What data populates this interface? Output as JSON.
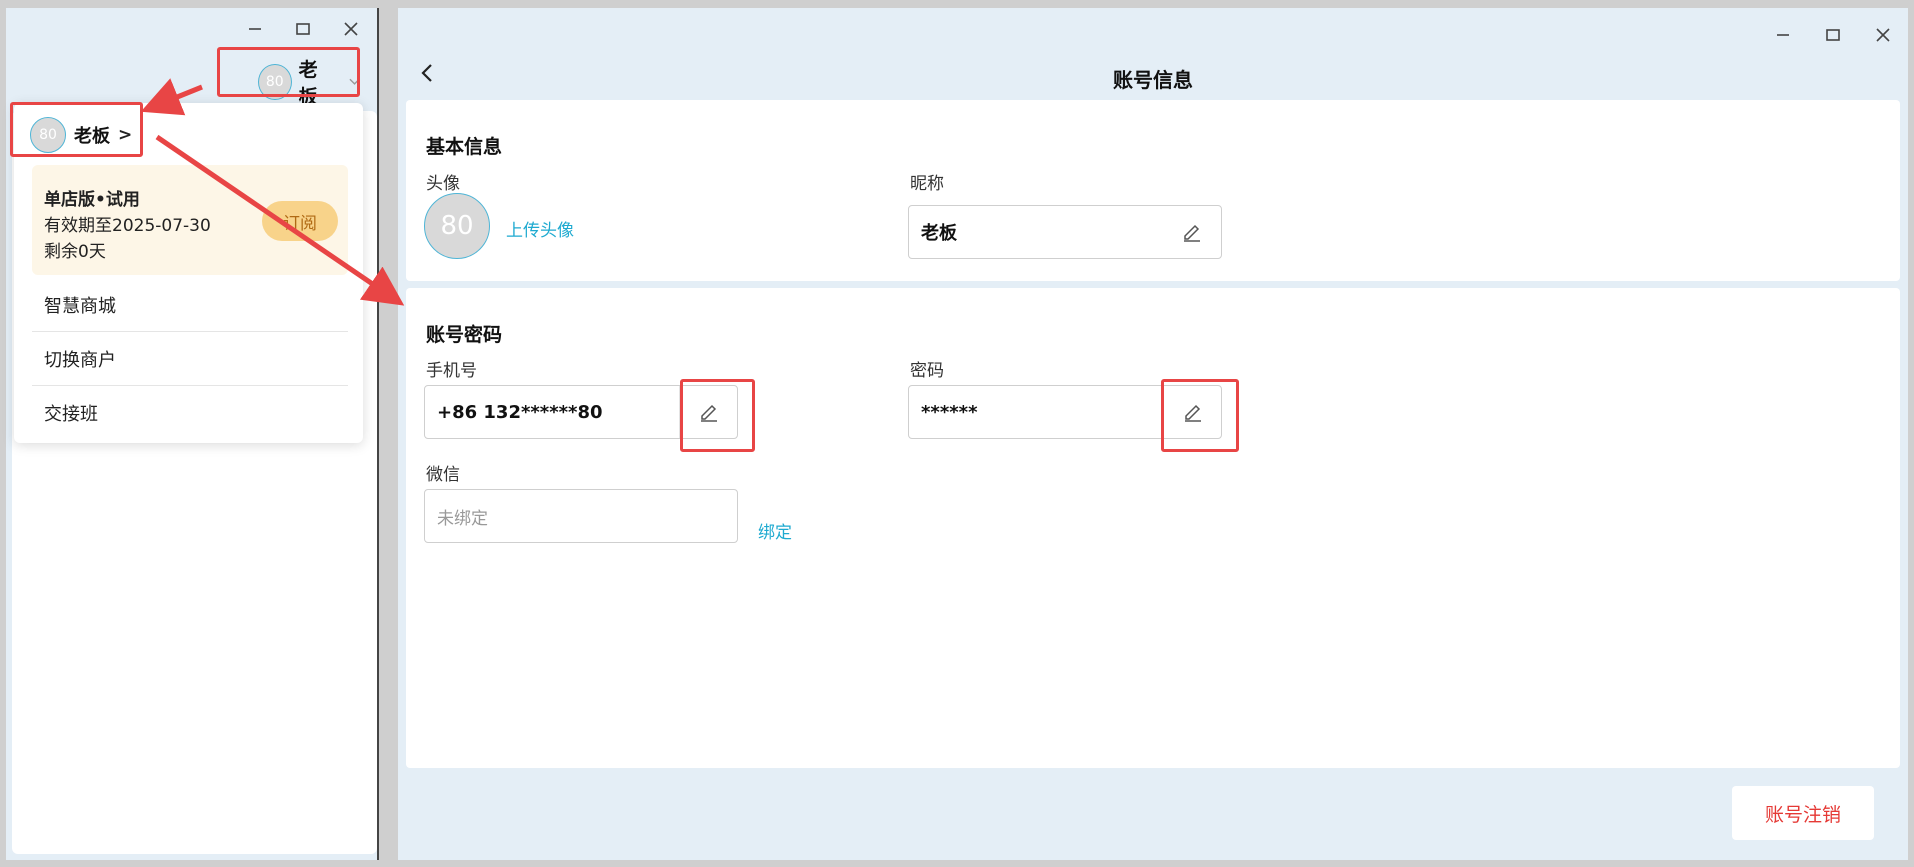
{
  "left_window": {
    "user": {
      "avatar_text": "80",
      "name": "老板"
    },
    "dropdown": {
      "user_label": "老板",
      "user_chevron": ">",
      "plan": {
        "name": "单店版•试用",
        "validity": "有效期至2025-07-30",
        "remaining": "剩余0天",
        "subscribe_label": "订阅"
      },
      "items": [
        {
          "label": "智慧商城"
        },
        {
          "label": "切换商户"
        },
        {
          "label": "交接班"
        }
      ]
    },
    "row_chevron": "›"
  },
  "right_window": {
    "page_title": "账号信息",
    "basic_info": {
      "section_title": "基本信息",
      "avatar_label": "头像",
      "avatar_text": "80",
      "upload_label": "上传头像",
      "nickname_label": "昵称",
      "nickname_value": "老板"
    },
    "account_password": {
      "section_title": "账号密码",
      "phone_label": "手机号",
      "phone_value": "+86 132******80",
      "password_label": "密码",
      "password_value": "******",
      "wechat_label": "微信",
      "wechat_placeholder": "未绑定",
      "bind_label": "绑定"
    },
    "cancel_account_label": "账号注销"
  },
  "colors": {
    "background": "#e4eef6",
    "accent": "#1eaad0",
    "danger": "#e53935",
    "highlight": "#e84545",
    "subscribe_bg": "#f8d38a"
  },
  "icons": [
    "minimize-icon",
    "maximize-icon",
    "close-icon",
    "back-icon",
    "edit-pencil-icon",
    "chevron-down-icon"
  ]
}
